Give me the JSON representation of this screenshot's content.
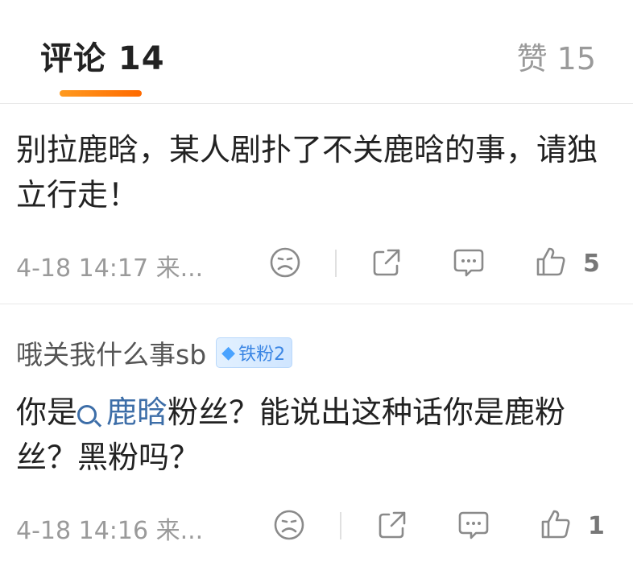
{
  "tabs": {
    "comments_label": "评论 14",
    "likes_label": "赞 15"
  },
  "comments": [
    {
      "text": "别拉鹿晗，某人剧扑了不关鹿晗的事，请独立行走！",
      "time": "4-18 14:17  来...",
      "like_count": "5"
    },
    {
      "author": "哦关我什么事sb",
      "badge": "铁粉2",
      "text_before": "你是",
      "topic": "鹿晗",
      "text_after": "粉丝？能说出这种话你是鹿粉丝？黑粉吗？",
      "time": "4-18 14:16  来...",
      "like_count": "1"
    }
  ],
  "icons": {
    "dislike": "sad-face-icon",
    "share": "share-icon",
    "reply": "comment-bubble-icon",
    "like": "thumbs-up-icon"
  },
  "colors": {
    "accent_underline": "#ff7a0f",
    "topic_link": "#3d6ea8",
    "badge_text": "#3b86e4"
  }
}
